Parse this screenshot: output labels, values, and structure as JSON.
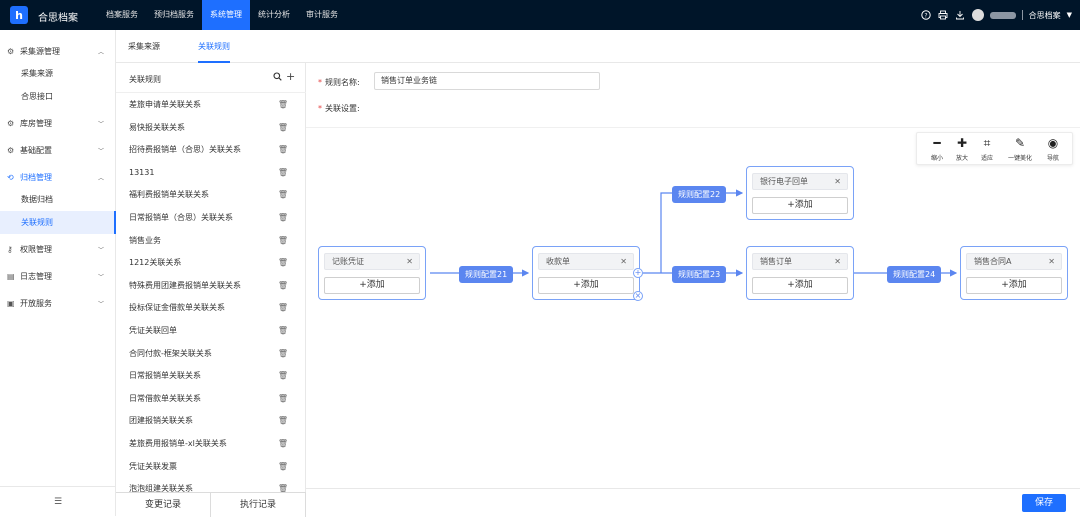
{
  "app": {
    "name": "合思档案",
    "logo_letter": "h"
  },
  "nav": [
    {
      "label": "档案服务"
    },
    {
      "label": "预归档服务"
    },
    {
      "label": "系统管理"
    },
    {
      "label": "统计分析"
    },
    {
      "label": "审计服务"
    }
  ],
  "user": {
    "org": "合思档案"
  },
  "sidebar": {
    "groups": [
      {
        "label": "采集源管理"
      },
      {
        "label": "库房管理"
      },
      {
        "label": "基础配置"
      },
      {
        "label": "归档管理"
      },
      {
        "label": "权限管理"
      },
      {
        "label": "日志管理"
      },
      {
        "label": "开放服务"
      }
    ],
    "subitems": [
      {
        "label": "采集来源"
      },
      {
        "label": "合思接口"
      },
      {
        "label": "数据归档"
      },
      {
        "label": "关联规则"
      }
    ]
  },
  "tabs": [
    {
      "label": "采集来源"
    },
    {
      "label": "关联规则"
    }
  ],
  "list": {
    "header": "关联规则",
    "items": [
      {
        "label": "差旅申请单关联关系"
      },
      {
        "label": "易快报关联关系"
      },
      {
        "label": "招待费报销单（合思）关联关系"
      },
      {
        "label": "13131"
      },
      {
        "label": "福利费报销单关联关系"
      },
      {
        "label": "日常报销单（合思）关联关系"
      },
      {
        "label": "销售业务"
      },
      {
        "label": "1212关联关系"
      },
      {
        "label": "特殊费用团建费报销单关联关系"
      },
      {
        "label": "投标保证金借款单关联关系"
      },
      {
        "label": "凭证关联回单"
      },
      {
        "label": "合同付款-框架关联关系"
      },
      {
        "label": "日常报销单关联关系"
      },
      {
        "label": "日常借款单关联关系"
      },
      {
        "label": "团建报销关联关系"
      },
      {
        "label": "差旅费用报销单-xl关联关系"
      },
      {
        "label": "凭证关联发票"
      },
      {
        "label": "泡泡组建关联关系"
      }
    ],
    "buttons": {
      "changes": "变更记录",
      "exec": "执行记录"
    }
  },
  "form": {
    "rule_name_label": "规则名称:",
    "rule_name_value": "销售订单业务链",
    "settings_label": "关联设置:"
  },
  "toolbar": [
    {
      "label": "缩小",
      "glyph": "━"
    },
    {
      "label": "放大",
      "glyph": "✚"
    },
    {
      "label": "适应",
      "glyph": "⌗"
    },
    {
      "label": "一键美化",
      "glyph": "✎"
    },
    {
      "label": "导航",
      "glyph": "◉"
    }
  ],
  "flow": {
    "nodes": [
      {
        "chip": "记账凭证",
        "add": "+添加"
      },
      {
        "chip": "收款单",
        "add": "+添加"
      },
      {
        "chip": "银行电子回单",
        "add": "+添加"
      },
      {
        "chip": "销售订单",
        "add": "+添加"
      },
      {
        "chip": "销售合同A",
        "add": "+添加"
      }
    ],
    "rules": [
      {
        "label": "规则配置21"
      },
      {
        "label": "规则配置22"
      },
      {
        "label": "规则配置23"
      },
      {
        "label": "规则配置24"
      }
    ]
  },
  "actions": {
    "save": "保存"
  },
  "colors": {
    "primary": "#1e6fff",
    "topbar": "#001529",
    "edge": "#5b86f0"
  }
}
